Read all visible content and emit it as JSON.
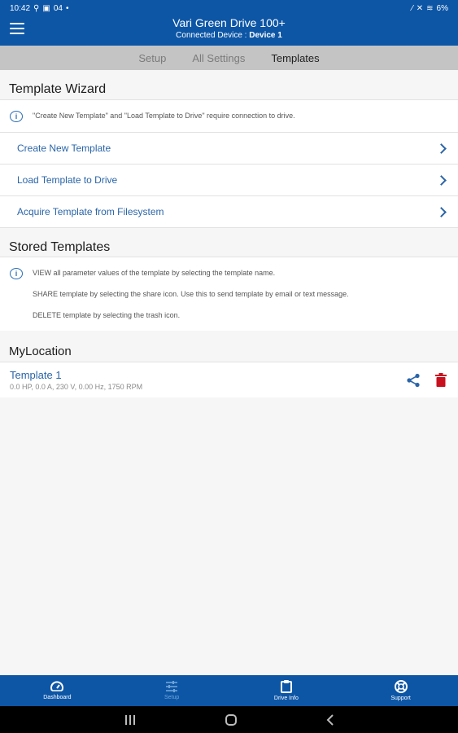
{
  "status_bar": {
    "time": "10:42",
    "indicators": "04",
    "battery": "6%"
  },
  "header": {
    "title": "Vari Green Drive 100+",
    "connected_label": "Connected Device :",
    "connected_device": "Device 1"
  },
  "tabs": [
    {
      "label": "Setup",
      "active": false
    },
    {
      "label": "All Settings",
      "active": false
    },
    {
      "label": "Templates",
      "active": true
    }
  ],
  "wizard": {
    "title": "Template Wizard",
    "info": "\"Create New Template\" and \"Load Template to Drive\" require connection to drive.",
    "items": [
      {
        "label": "Create New Template"
      },
      {
        "label": "Load Template to Drive"
      },
      {
        "label": "Acquire Template from Filesystem"
      }
    ]
  },
  "stored": {
    "title": "Stored Templates",
    "info_lines": [
      "VIEW all parameter values of the template by selecting the template name.",
      "SHARE template by selecting the share icon.  Use this to send template by email or text message.",
      "DELETE template by selecting the trash icon."
    ]
  },
  "location": {
    "title": "MyLocation",
    "templates": [
      {
        "name": "Template 1",
        "details": "0.0 HP, 0.0 A, 230 V, 0.00 Hz, 1750 RPM"
      }
    ]
  },
  "bottom_nav": [
    {
      "label": "Dashboard",
      "icon": "gauge-icon",
      "active": false
    },
    {
      "label": "Setup",
      "icon": "sliders-icon",
      "active": true
    },
    {
      "label": "Drive Info",
      "icon": "clipboard-icon",
      "active": false
    },
    {
      "label": "Support",
      "icon": "lifebuoy-icon",
      "active": false
    }
  ],
  "colors": {
    "brand": "#0d56a6",
    "link": "#2a65a8",
    "delete": "#c8101e",
    "tab_bar": "#c4c4c4"
  }
}
